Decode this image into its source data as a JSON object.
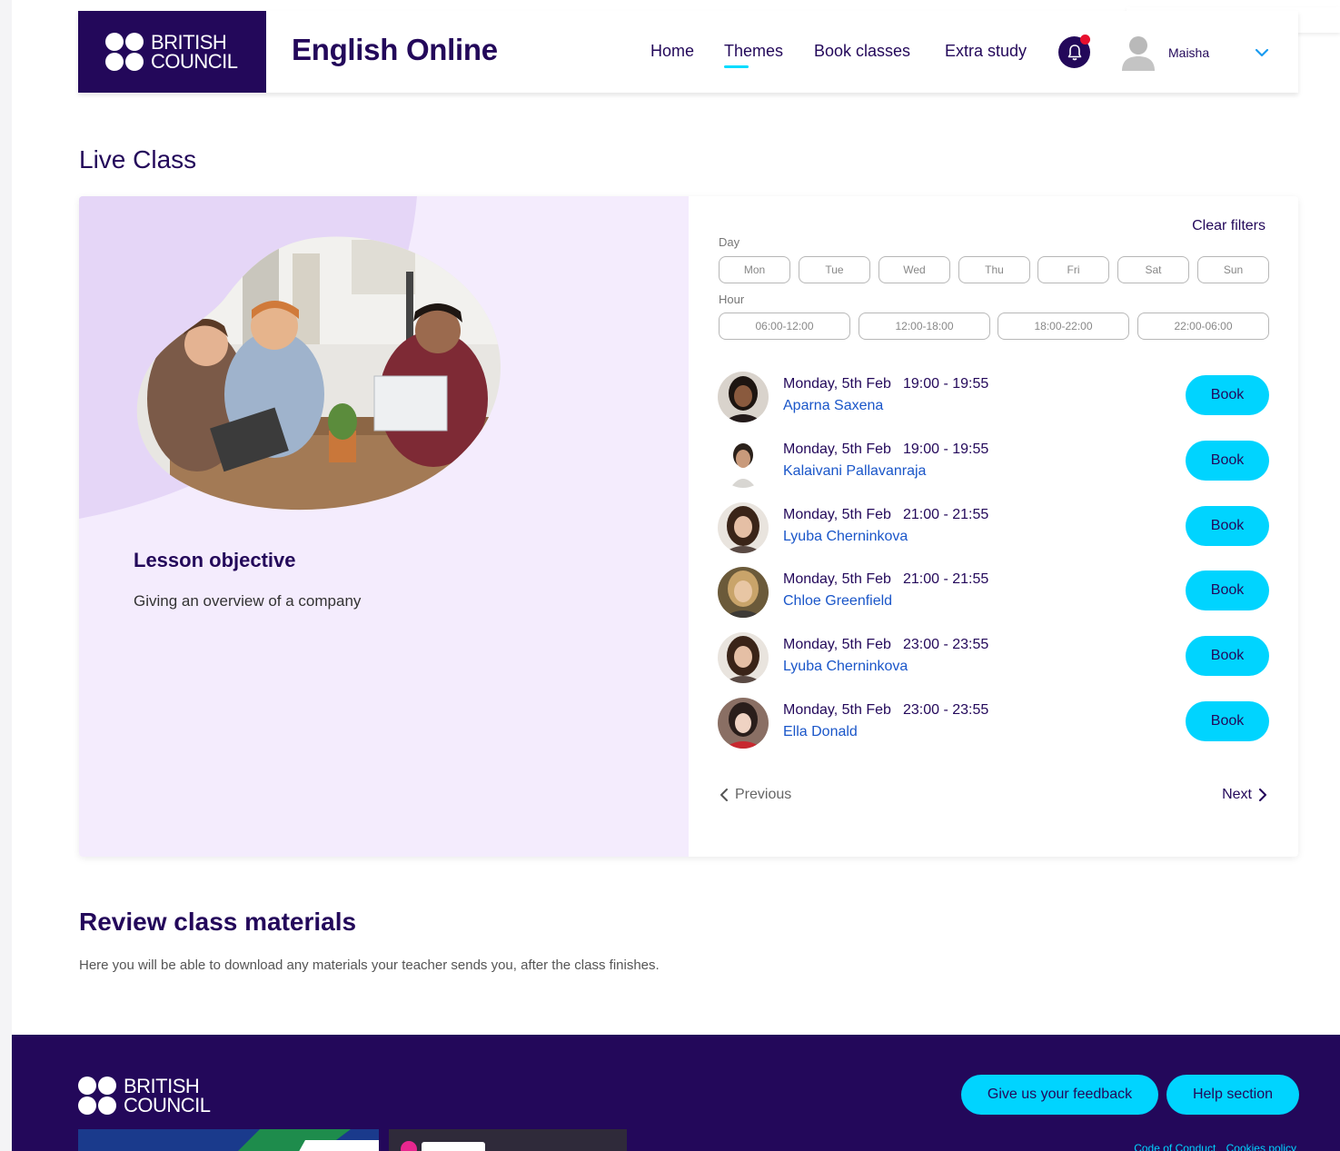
{
  "brand": {
    "logo_text": "BRITISH\nCOUNCIL",
    "app_title": "English Online"
  },
  "nav": {
    "home": "Home",
    "themes": "Themes",
    "book_classes": "Book classes",
    "extra_study": "Extra study",
    "user_name": "Maisha"
  },
  "live_class": {
    "title": "Live Class",
    "lesson_objective_title": "Lesson objective",
    "lesson_objective_text": "Giving an overview of a company"
  },
  "filters": {
    "clear_label": "Clear filters",
    "day_label": "Day",
    "days": [
      "Mon",
      "Tue",
      "Wed",
      "Thu",
      "Fri",
      "Sat",
      "Sun"
    ],
    "hour_label": "Hour",
    "hours": [
      "06:00-12:00",
      "12:00-18:00",
      "18:00-22:00",
      "22:00-06:00"
    ]
  },
  "slots": [
    {
      "date": "Monday, 5th Feb",
      "time": "19:00 - 19:55",
      "teacher": "Aparna Saxena",
      "button": "Book"
    },
    {
      "date": "Monday, 5th Feb",
      "time": "19:00 - 19:55",
      "teacher": "Kalaivani Pallavanraja",
      "button": "Book"
    },
    {
      "date": "Monday, 5th Feb",
      "time": "21:00 - 21:55",
      "teacher": "Lyuba Cherninkova",
      "button": "Book"
    },
    {
      "date": "Monday, 5th Feb",
      "time": "21:00 - 21:55",
      "teacher": "Chloe Greenfield",
      "button": "Book"
    },
    {
      "date": "Monday, 5th Feb",
      "time": "23:00 - 23:55",
      "teacher": "Lyuba Cherninkova",
      "button": "Book"
    },
    {
      "date": "Monday, 5th Feb",
      "time": "23:00 - 23:55",
      "teacher": "Ella Donald",
      "button": "Book"
    }
  ],
  "pager": {
    "previous": "Previous",
    "next": "Next"
  },
  "review": {
    "title": "Review class materials",
    "text": "Here you will be able to download any materials your teacher sends you, after the class finishes."
  },
  "footer": {
    "logo_text": "BRITISH\nCOUNCIL",
    "feedback_button": "Give us your feedback",
    "help_button": "Help section",
    "links": [
      "Code of Conduct",
      "Cookies policy"
    ]
  },
  "colors": {
    "brand_navy": "#23085a",
    "accent_cyan": "#00d4ff",
    "panel_lilac": "#f4ecfd",
    "link_blue": "#1a56c9",
    "alert_red": "#e8102e"
  }
}
